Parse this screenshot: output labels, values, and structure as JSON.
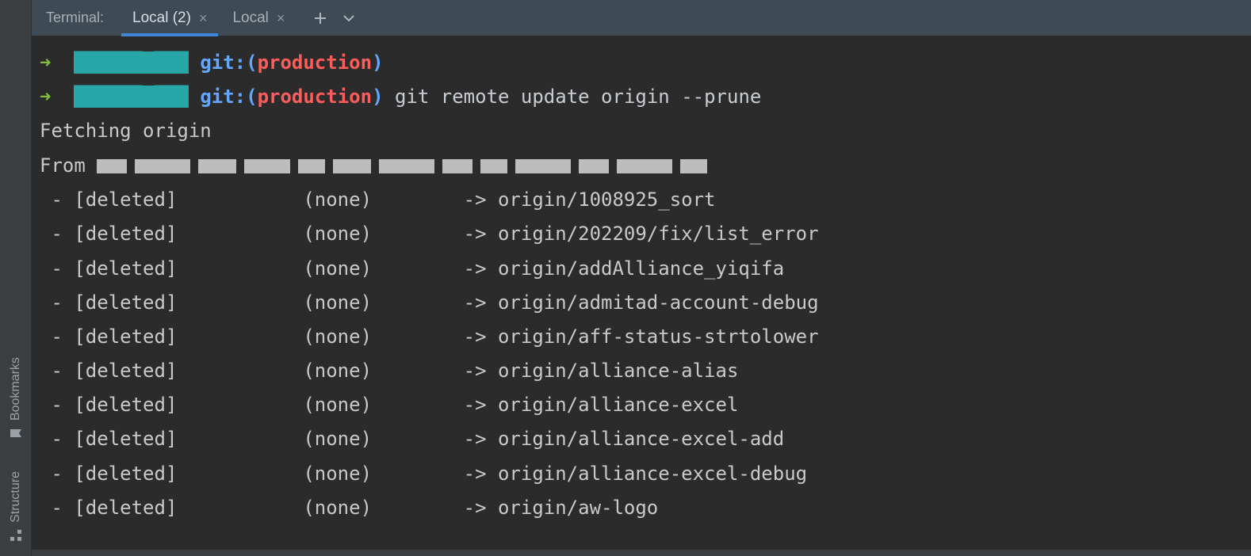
{
  "sidebar": {
    "items": [
      {
        "label": "Structure"
      },
      {
        "label": "Bookmarks"
      }
    ]
  },
  "tabbar": {
    "title": "Terminal:",
    "tabs": [
      {
        "label": "Local (2)",
        "active": true
      },
      {
        "label": "Local",
        "active": false
      }
    ]
  },
  "terminal": {
    "prompt": {
      "arrow": "➜",
      "git_label": "git:",
      "branch": "production"
    },
    "command": "git remote update origin --prune",
    "fetch_line": "Fetching origin",
    "from_prefix": "From ",
    "deletions": {
      "status": "[deleted]",
      "source": "(none)",
      "arrow": "->",
      "refs": [
        "origin/1008925_sort",
        "origin/202209/fix/list_error",
        "origin/addAlliance_yiqifa",
        "origin/admitad-account-debug",
        "origin/aff-status-strtolower",
        "origin/alliance-alias",
        "origin/alliance-excel",
        "origin/alliance-excel-add",
        "origin/alliance-excel-debug",
        "origin/aw-logo"
      ]
    }
  }
}
